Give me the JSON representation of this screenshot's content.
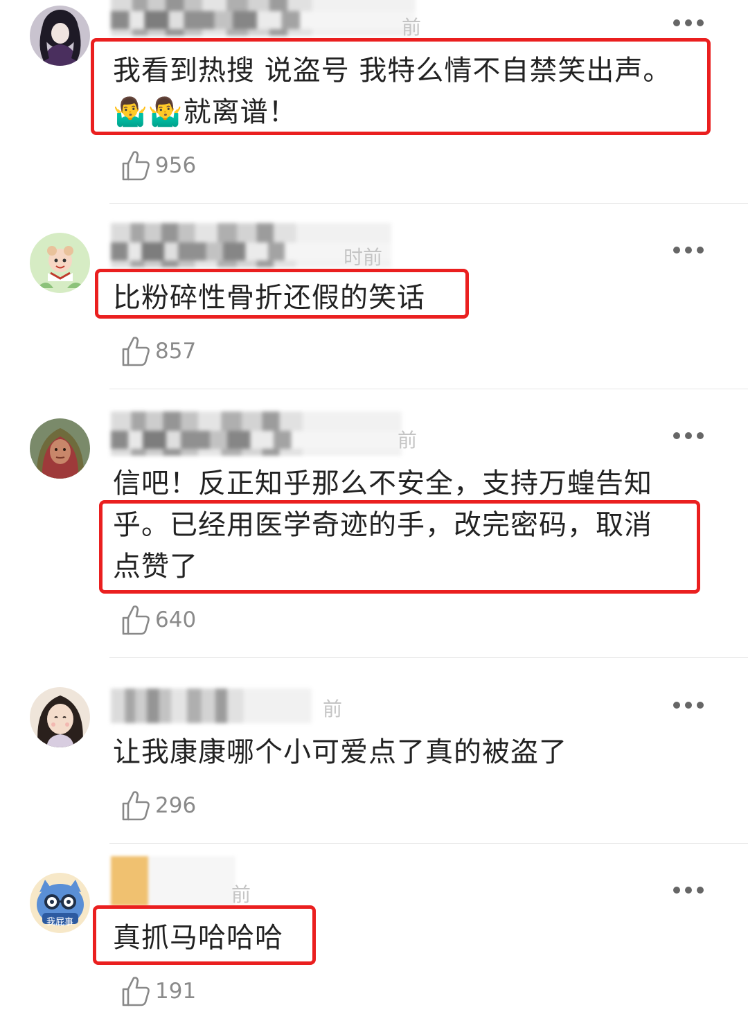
{
  "comments": [
    {
      "text_lines": [
        "我看到热搜 说盗号 我特么情不自禁笑出声。",
        "🤷‍♂️🤷‍♂️就离谱！"
      ],
      "likes": "956",
      "time_hint": "前",
      "avatar": "dark-haired-anime-girl"
    },
    {
      "text_lines": [
        "比粉碎性骨折还假的笑话"
      ],
      "likes": "857",
      "time_hint": "时前",
      "avatar": "cartoon-character-green"
    },
    {
      "text_lines": [
        "信吧！反正知乎那么不安全，支持万蝗告知",
        "乎。已经用医学奇迹的手，改完密码，取消",
        "点赞了"
      ],
      "likes": "640",
      "time_hint": "前",
      "avatar": "woman-headscarf"
    },
    {
      "text_lines": [
        "让我康康哪个小可爱点了真的被盗了"
      ],
      "likes": "296",
      "time_hint": "前",
      "avatar": "illustrated-girl"
    },
    {
      "text_lines": [
        "真抓马哈哈哈"
      ],
      "likes": "191",
      "time_hint": "前",
      "avatar": "blue-cat-glasses",
      "avatar_caption": "我屁事"
    }
  ],
  "colors": {
    "highlight": "#ea1f1f",
    "text": "#222222",
    "meta": "#8a8a8a",
    "divider": "#e6e6e6"
  },
  "icons": {
    "like": "thumbs-up-outline-icon",
    "more": "more-horizontal-icon"
  }
}
